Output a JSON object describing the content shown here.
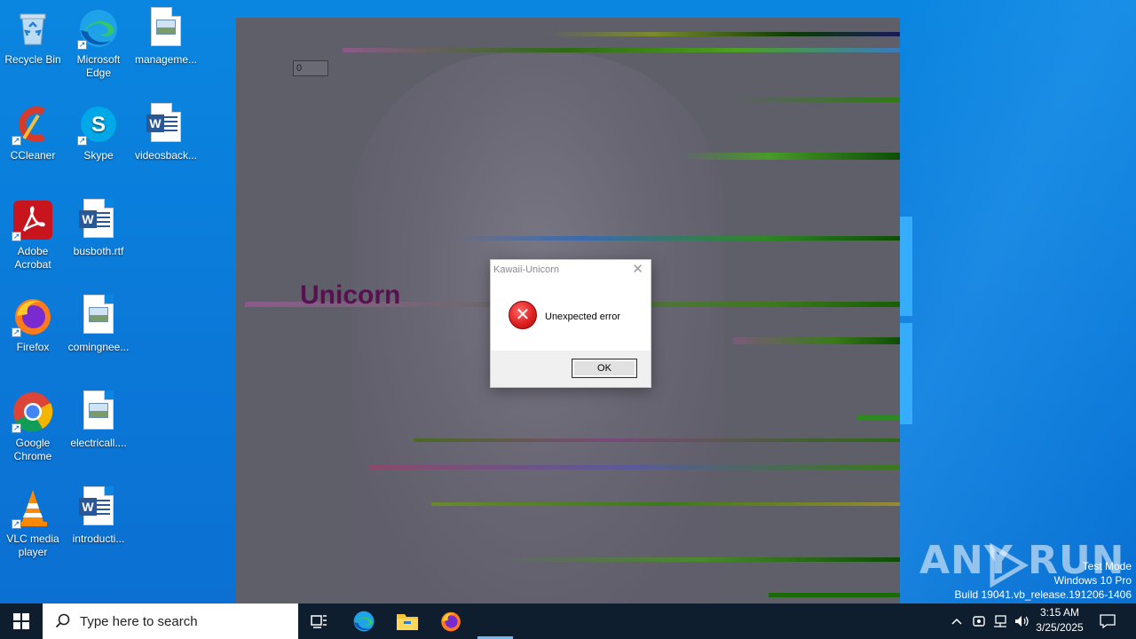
{
  "desktop": {
    "icons": [
      {
        "label": "Recycle Bin"
      },
      {
        "label": "Microsoft Edge"
      },
      {
        "label": "manageme..."
      },
      {
        "label": "CCleaner"
      },
      {
        "label": "Skype"
      },
      {
        "label": "videosback..."
      },
      {
        "label": "Adobe Acrobat"
      },
      {
        "label": "busboth.rtf"
      },
      {
        "label": "Firefox"
      },
      {
        "label": "comingnee..."
      },
      {
        "label": "Google Chrome"
      },
      {
        "label": "electricall...."
      },
      {
        "label": "VLC media player"
      },
      {
        "label": "introducti..."
      }
    ]
  },
  "app_window": {
    "field_value": "0",
    "title_text": "Unicorn"
  },
  "dialog": {
    "title": "Kawaii-Unicorn",
    "message": "Unexpected error",
    "ok_label": "OK",
    "close_glyph": "✕",
    "icon": "error-icon"
  },
  "watermark": {
    "brand": "ANY RUN",
    "line1": "Test Mode",
    "line2": "Windows 10 Pro",
    "line3": "Build 19041.vb_release.191206-1406"
  },
  "taskbar": {
    "search_placeholder": "Type here to search",
    "apps": [
      "task-view",
      "edge",
      "file-explorer",
      "firefox"
    ],
    "clock_time": "3:15 AM",
    "clock_date": "3/25/2025",
    "accent": "#76b9ed"
  }
}
